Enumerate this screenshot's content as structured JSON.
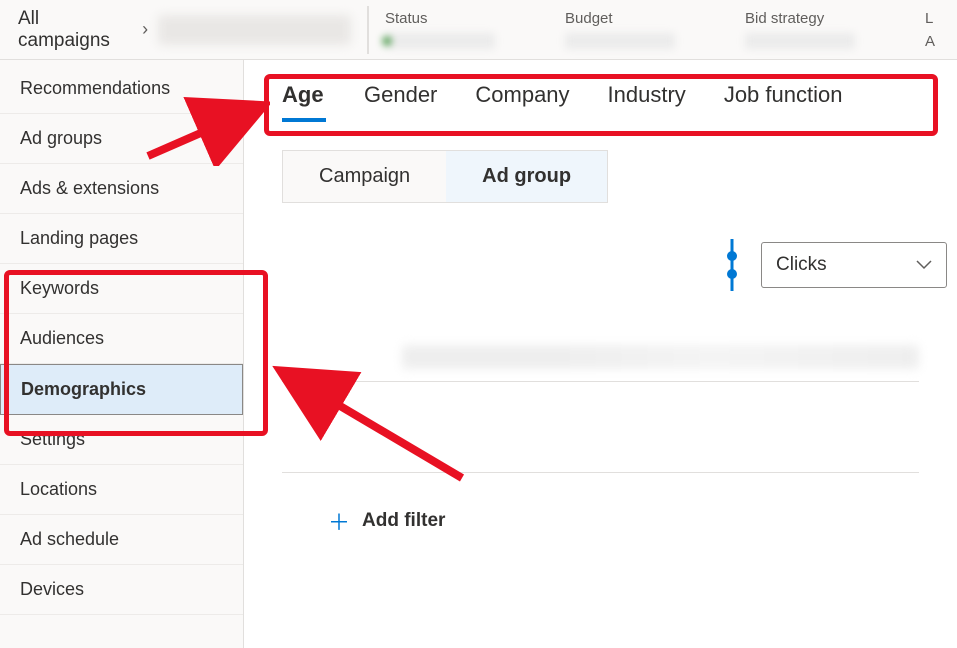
{
  "breadcrumb": {
    "root": "All campaigns"
  },
  "top_stats": {
    "status_label": "Status",
    "budget_label": "Budget",
    "bid_strategy_label": "Bid strategy",
    "last_label": "L",
    "last_value_prefix": "A"
  },
  "sidebar": {
    "items": [
      {
        "label": "Recommendations",
        "name": "sidebar-item-recommendations",
        "active": false
      },
      {
        "label": "Ad groups",
        "name": "sidebar-item-ad-groups",
        "active": false
      },
      {
        "label": "Ads & extensions",
        "name": "sidebar-item-ads-extensions",
        "active": false
      },
      {
        "label": "Landing pages",
        "name": "sidebar-item-landing-pages",
        "active": false
      },
      {
        "label": "Keywords",
        "name": "sidebar-item-keywords",
        "active": false
      },
      {
        "label": "Audiences",
        "name": "sidebar-item-audiences",
        "active": false
      },
      {
        "label": "Demographics",
        "name": "sidebar-item-demographics",
        "active": true
      },
      {
        "label": "Settings",
        "name": "sidebar-item-settings",
        "active": false
      },
      {
        "label": "Locations",
        "name": "sidebar-item-locations",
        "active": false
      },
      {
        "label": "Ad schedule",
        "name": "sidebar-item-ad-schedule",
        "active": false
      },
      {
        "label": "Devices",
        "name": "sidebar-item-devices",
        "active": false
      }
    ]
  },
  "demo_tabs": {
    "items": [
      {
        "label": "Age",
        "name": "tab-age",
        "active": true
      },
      {
        "label": "Gender",
        "name": "tab-gender",
        "active": false
      },
      {
        "label": "Company",
        "name": "tab-company",
        "active": false
      },
      {
        "label": "Industry",
        "name": "tab-industry",
        "active": false
      },
      {
        "label": "Job function",
        "name": "tab-job-function",
        "active": false
      }
    ]
  },
  "scope_tabs": {
    "campaign": "Campaign",
    "ad_group": "Ad group"
  },
  "metric_dropdown": {
    "selected": "Clicks"
  },
  "add_filter_label": "Add filter",
  "colors": {
    "accent": "#0078d4",
    "annotation": "#e81123"
  }
}
